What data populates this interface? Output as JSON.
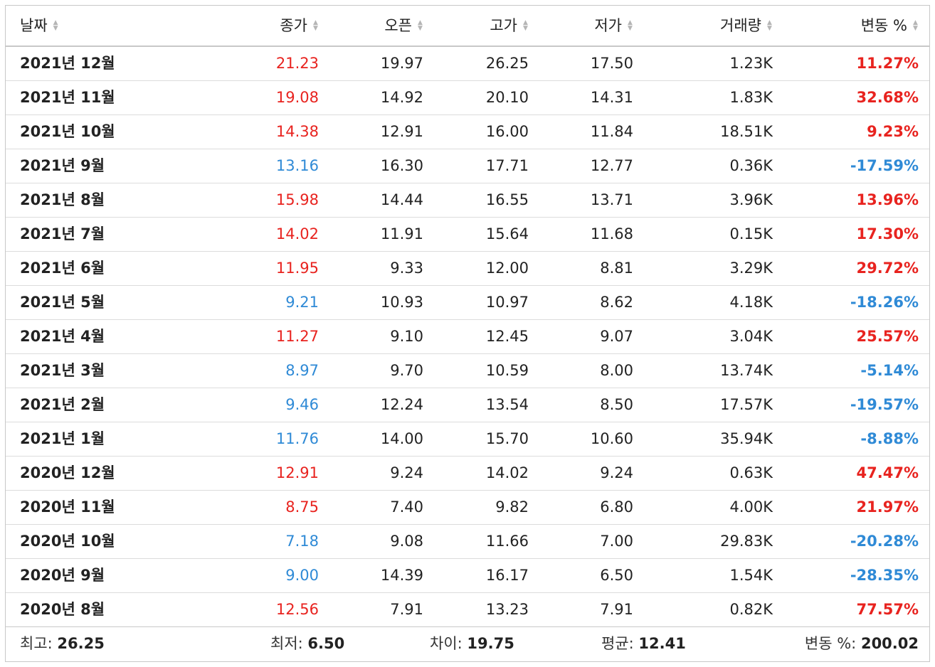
{
  "headers": {
    "date": "날짜",
    "close": "종가",
    "open": "오픈",
    "high": "고가",
    "low": "저가",
    "volume": "거래량",
    "change": "변동 %"
  },
  "colors": {
    "up": "#e8231f",
    "down": "#2f8ad6"
  },
  "sort_icon": "sort-updown-icon",
  "rows": [
    {
      "date": "2021년 12월",
      "close": "21.23",
      "open": "19.97",
      "high": "26.25",
      "low": "17.50",
      "volume": "1.23K",
      "change": "11.27%",
      "dir": "up"
    },
    {
      "date": "2021년 11월",
      "close": "19.08",
      "open": "14.92",
      "high": "20.10",
      "low": "14.31",
      "volume": "1.83K",
      "change": "32.68%",
      "dir": "up"
    },
    {
      "date": "2021년 10월",
      "close": "14.38",
      "open": "12.91",
      "high": "16.00",
      "low": "11.84",
      "volume": "18.51K",
      "change": "9.23%",
      "dir": "up"
    },
    {
      "date": "2021년 9월",
      "close": "13.16",
      "open": "16.30",
      "high": "17.71",
      "low": "12.77",
      "volume": "0.36K",
      "change": "-17.59%",
      "dir": "down"
    },
    {
      "date": "2021년 8월",
      "close": "15.98",
      "open": "14.44",
      "high": "16.55",
      "low": "13.71",
      "volume": "3.96K",
      "change": "13.96%",
      "dir": "up"
    },
    {
      "date": "2021년 7월",
      "close": "14.02",
      "open": "11.91",
      "high": "15.64",
      "low": "11.68",
      "volume": "0.15K",
      "change": "17.30%",
      "dir": "up"
    },
    {
      "date": "2021년 6월",
      "close": "11.95",
      "open": "9.33",
      "high": "12.00",
      "low": "8.81",
      "volume": "3.29K",
      "change": "29.72%",
      "dir": "up"
    },
    {
      "date": "2021년 5월",
      "close": "9.21",
      "open": "10.93",
      "high": "10.97",
      "low": "8.62",
      "volume": "4.18K",
      "change": "-18.26%",
      "dir": "down"
    },
    {
      "date": "2021년 4월",
      "close": "11.27",
      "open": "9.10",
      "high": "12.45",
      "low": "9.07",
      "volume": "3.04K",
      "change": "25.57%",
      "dir": "up"
    },
    {
      "date": "2021년 3월",
      "close": "8.97",
      "open": "9.70",
      "high": "10.59",
      "low": "8.00",
      "volume": "13.74K",
      "change": "-5.14%",
      "dir": "down"
    },
    {
      "date": "2021년 2월",
      "close": "9.46",
      "open": "12.24",
      "high": "13.54",
      "low": "8.50",
      "volume": "17.57K",
      "change": "-19.57%",
      "dir": "down"
    },
    {
      "date": "2021년 1월",
      "close": "11.76",
      "open": "14.00",
      "high": "15.70",
      "low": "10.60",
      "volume": "35.94K",
      "change": "-8.88%",
      "dir": "down"
    },
    {
      "date": "2020년 12월",
      "close": "12.91",
      "open": "9.24",
      "high": "14.02",
      "low": "9.24",
      "volume": "0.63K",
      "change": "47.47%",
      "dir": "up"
    },
    {
      "date": "2020년 11월",
      "close": "8.75",
      "open": "7.40",
      "high": "9.82",
      "low": "6.80",
      "volume": "4.00K",
      "change": "21.97%",
      "dir": "up"
    },
    {
      "date": "2020년 10월",
      "close": "7.18",
      "open": "9.08",
      "high": "11.66",
      "low": "7.00",
      "volume": "29.83K",
      "change": "-20.28%",
      "dir": "down"
    },
    {
      "date": "2020년 9월",
      "close": "9.00",
      "open": "14.39",
      "high": "16.17",
      "low": "6.50",
      "volume": "1.54K",
      "change": "-28.35%",
      "dir": "down"
    },
    {
      "date": "2020년 8월",
      "close": "12.56",
      "open": "7.91",
      "high": "13.23",
      "low": "7.91",
      "volume": "0.82K",
      "change": "77.57%",
      "dir": "up"
    }
  ],
  "footer": {
    "high_label": "최고:",
    "high_value": "26.25",
    "low_label": "최저:",
    "low_value": "6.50",
    "diff_label": "차이:",
    "diff_value": "19.75",
    "avg_label": "평균:",
    "avg_value": "12.41",
    "change_label": "변동 %:",
    "change_value": "200.02"
  }
}
